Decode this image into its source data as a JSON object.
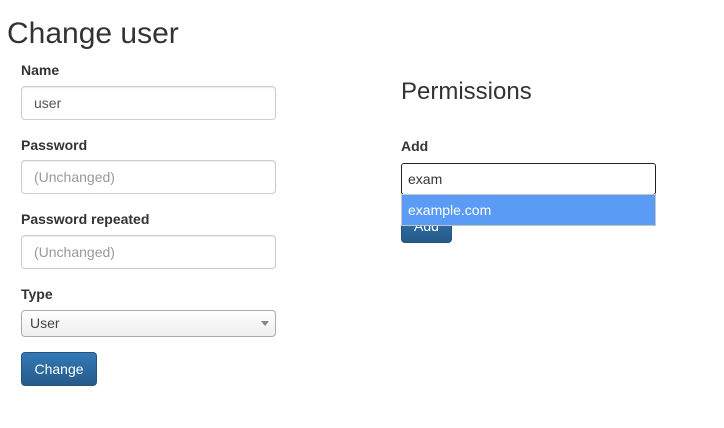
{
  "page": {
    "title": "Change user"
  },
  "form": {
    "name": {
      "label": "Name",
      "value": "user"
    },
    "password": {
      "label": "Password",
      "placeholder": "(Unchanged)"
    },
    "password_repeated": {
      "label": "Password repeated",
      "placeholder": "(Unchanged)"
    },
    "type": {
      "label": "Type",
      "selected": "User"
    },
    "submit_label": "Change"
  },
  "permissions": {
    "title": "Permissions",
    "add": {
      "label": "Add",
      "value": "exam",
      "suggestions": [
        "example.com"
      ],
      "button_label": "Add"
    }
  },
  "colors": {
    "primary": "#337ab7",
    "highlight": "#5a9bf5"
  }
}
